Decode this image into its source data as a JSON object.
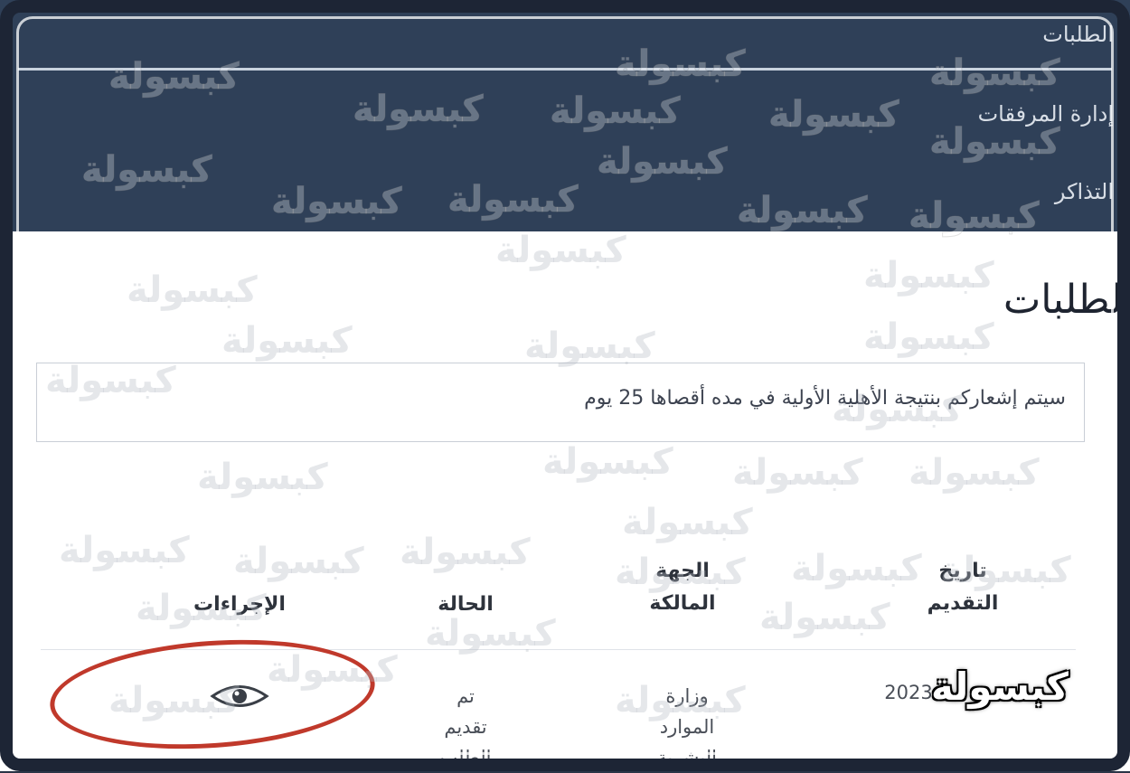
{
  "menu": {
    "items": [
      {
        "label": "الطلبات"
      },
      {
        "label": "إدارة المرفقات"
      },
      {
        "label": "التذاكر"
      }
    ]
  },
  "page": {
    "title": "لطلبات",
    "notice": "سيتم إشعاركم بنتيجة الأهلية الأولية في مده أقصاها 25 يوم"
  },
  "table": {
    "headers": {
      "date": [
        "تاريخ",
        "التقديم"
      ],
      "owner": [
        "الجهة",
        "المالكة"
      ],
      "status": [
        "الحالة"
      ],
      "actions": [
        "الإجراءات"
      ]
    },
    "row": {
      "date": "2023",
      "owner": [
        "وزارة",
        "الموارد",
        "البشرية"
      ],
      "status": [
        "تم",
        "تقديم",
        "الطلب"
      ]
    }
  },
  "icons": {
    "view": "eye-icon"
  },
  "colors": {
    "header_bg": "#2f4058",
    "annotation": "#c0392b",
    "watermark": "#ffffff"
  },
  "watermark": {
    "text": "كبسولة"
  },
  "logo": {
    "text": "كبسولة"
  }
}
